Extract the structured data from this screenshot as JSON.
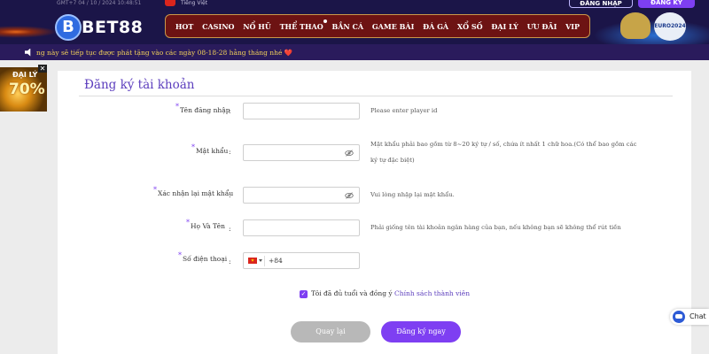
{
  "header": {
    "top_strip": "GMT+7 04 / 10 / 2024 10:48:51",
    "language": "Tiếng Việt",
    "login_label": "ĐĂNG NHẬP",
    "register_label": "ĐĂNG KÝ",
    "logo_mark": "B",
    "logo_text": "BET88",
    "nav": [
      "HOT",
      "CASINO",
      "NỔ HŨ",
      "THỂ THAO",
      "BẮN CÁ",
      "GAME BÀI",
      "ĐÁ GÀ",
      "XỔ SỐ",
      "ĐẠI LÝ",
      "ƯU ĐÃI",
      "VIP"
    ],
    "euro_badge": "EURO2024"
  },
  "marquee": {
    "text": "ng này sẽ tiếp tục được phát tặng vào các ngày 08-18-28 hằng tháng nhé ❤️"
  },
  "promo": {
    "title": "ĐẠI LÝ",
    "percent": "70%",
    "close": "✕"
  },
  "form": {
    "title": "Đăng ký tài khoản",
    "fields": [
      {
        "label": "Tên đăng nhập",
        "hint": "Please enter player id"
      },
      {
        "label": "Mật khẩu",
        "hint_line1": "Mật khẩu phải bao gồm từ 8~20 ký tự / số, chứa ít nhất 1 chữ hoa.(Có thể bao gồm các",
        "hint_line2": "ký tự đặc biệt)"
      },
      {
        "label": "Xác nhận lại mật khẩu",
        "hint": "Vui lòng nhập lại mật khẩu."
      },
      {
        "label": "Họ Và Tên",
        "hint": "Phải giống tên tài khoản ngân hàng của bạn, nếu không bạn sẽ không thể rút tiền"
      },
      {
        "label": "Số điện thoại",
        "value": "+84"
      }
    ],
    "agree_text": "Tôi đã đủ tuổi và đồng ý",
    "agree_link": "Chính sách thành viên",
    "back_label": "Quay lại",
    "submit_label": "Đăng ký ngay"
  },
  "chat": {
    "label": "Chat"
  }
}
